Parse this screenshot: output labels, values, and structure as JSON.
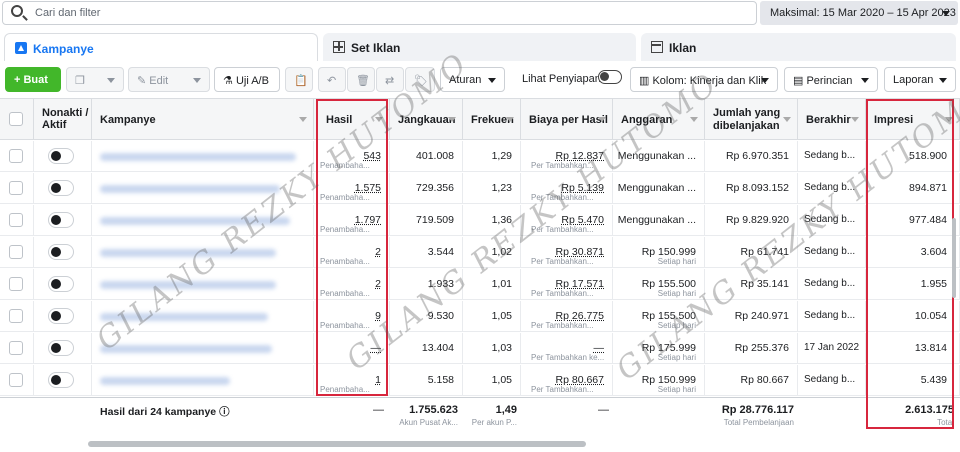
{
  "search": {
    "placeholder": "Cari dan filter"
  },
  "date_range": "Maksimal: 15 Mar 2020 – 15 Apr 2023",
  "tabs": [
    {
      "label": "Kampanye"
    },
    {
      "label": "Set Iklan"
    },
    {
      "label": "Iklan"
    }
  ],
  "toolbar": {
    "create": "+ Buat",
    "edit": "Edit",
    "abtest": "Uji A/B",
    "rules": "Aturan",
    "view_setup": "Lihat Penyiapan",
    "columns": "Kolom: Kinerja dan Klik",
    "breakdown": "Perincian",
    "reports": "Laporan"
  },
  "headers": {
    "onoff": "Nonakti / Aktif",
    "campaign": "Kampanye",
    "results": "Hasil",
    "reach": "Jangkauan",
    "frequency": "Frekuen",
    "cpr": "Biaya per Hasil",
    "budget": "Anggaran",
    "spent": "Jumlah yang dibelanjakan",
    "ends": "Berakhir",
    "impressions": "Impresi"
  },
  "rows": [
    {
      "results": "543",
      "results_sub": "Penambaha...",
      "reach": "401.008",
      "freq": "1,29",
      "cpr": "Rp 12.837",
      "cpr_sub": "Per Tambahkan...",
      "budget": "Menggunakan ...",
      "budget_sub": "",
      "spent": "Rp 6.970.351",
      "ends": "Sedang b...",
      "impr": "518.900"
    },
    {
      "results": "1.575",
      "results_sub": "Penambaha...",
      "reach": "729.356",
      "freq": "1,23",
      "cpr": "Rp 5.139",
      "cpr_sub": "Per Tambahkan...",
      "budget": "Menggunakan ...",
      "budget_sub": "",
      "spent": "Rp 8.093.152",
      "ends": "Sedang b...",
      "impr": "894.871"
    },
    {
      "results": "1.797",
      "results_sub": "Penambaha...",
      "reach": "719.509",
      "freq": "1,36",
      "cpr": "Rp 5.470",
      "cpr_sub": "Per Tambahkan...",
      "budget": "Menggunakan ...",
      "budget_sub": "",
      "spent": "Rp 9.829.920",
      "ends": "Sedang b...",
      "impr": "977.484"
    },
    {
      "results": "2",
      "results_sub": "Penambaha...",
      "reach": "3.544",
      "freq": "1,02",
      "cpr": "Rp 30.871",
      "cpr_sub": "Per Tambahkan...",
      "budget": "Rp 150.999",
      "budget_sub": "Setiap hari",
      "spent": "Rp 61.741",
      "ends": "Sedang b...",
      "impr": "3.604"
    },
    {
      "results": "2",
      "results_sub": "Penambaha...",
      "reach": "1.933",
      "freq": "1,01",
      "cpr": "Rp 17.571",
      "cpr_sub": "Per Tambahkan...",
      "budget": "Rp 155.500",
      "budget_sub": "Setiap hari",
      "spent": "Rp 35.141",
      "ends": "Sedang b...",
      "impr": "1.955"
    },
    {
      "results": "9",
      "results_sub": "Penambaha...",
      "reach": "9.530",
      "freq": "1,05",
      "cpr": "Rp 26.775",
      "cpr_sub": "Per Tambahkan...",
      "budget": "Rp 155.500",
      "budget_sub": "Setiap hari",
      "spent": "Rp 240.971",
      "ends": "Sedang b...",
      "impr": "10.054"
    },
    {
      "results": "—",
      "results_sub": "",
      "reach": "13.404",
      "freq": "1,03",
      "cpr": "—",
      "cpr_sub": "Per Tambahkan ke...",
      "budget": "Rp 175.999",
      "budget_sub": "Setiap hari",
      "spent": "Rp 255.376",
      "ends": "17 Jan 2022",
      "impr": "13.814"
    },
    {
      "results": "1",
      "results_sub": "Penambaha...",
      "reach": "5.158",
      "freq": "1,05",
      "cpr": "Rp 80.667",
      "cpr_sub": "Per Tambahkan...",
      "budget": "Rp 150.999",
      "budget_sub": "Setiap hari",
      "spent": "Rp 80.667",
      "ends": "Sedang b...",
      "impr": "5.439"
    }
  ],
  "footer": {
    "label": "Hasil dari 24 kampanye",
    "results": "—",
    "reach": "1.755.623",
    "reach_sub": "Akun Pusat Ak...",
    "freq": "1,49",
    "freq_sub": "Per akun P...",
    "cpr": "—",
    "spent": "Rp 28.776.117",
    "spent_sub": "Total Pembelanjaan",
    "impr": "2.613.175",
    "impr_sub": "Total"
  },
  "watermark": "GILANG REZKY HUTOMO",
  "colors": {
    "accent": "#1877f2",
    "highlight": "#d7263d",
    "create": "#42b72a"
  }
}
